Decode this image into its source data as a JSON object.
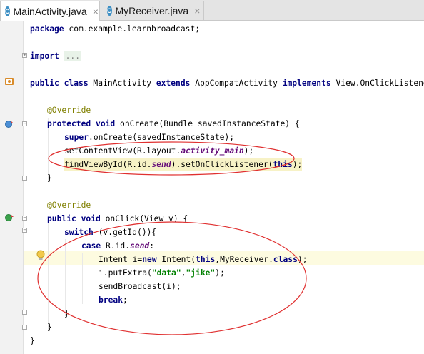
{
  "tabs": [
    {
      "icon": "C",
      "label": "MainActivity.java",
      "close": "×"
    },
    {
      "icon": "C",
      "label": "MyReceiver.java",
      "close": "×"
    }
  ],
  "code": {
    "l1": {
      "a": "package",
      "b": " com.example.learnbroadcast;"
    },
    "l2": {
      "a": "import",
      "b": "..."
    },
    "l3": {
      "a": "public class",
      "b": " MainActivity ",
      "c": "extends",
      "d": " AppCompatActivity ",
      "e": "implements",
      "f": " View.OnClickListener {"
    },
    "l4": {
      "a": "@Override"
    },
    "l5": {
      "a": "protected void",
      "b": " onCreate(Bundle savedInstanceState) {"
    },
    "l6": {
      "a": "super",
      "b": ".onCreate(savedInstanceState);"
    },
    "l7": {
      "a": "setContentView(R.layout.",
      "b": "activity_main",
      "c": ");"
    },
    "l8": {
      "a": "findViewById(R.id.",
      "b": "send",
      "c": ").setOnClickListener(",
      "d": "this",
      "e": ");"
    },
    "l9": {
      "a": "}"
    },
    "l10": {
      "a": "@Override"
    },
    "l11": {
      "a": "public void",
      "b": " onClick(View v) {"
    },
    "l12": {
      "a": "switch",
      "b": " (v.getId()){"
    },
    "l13": {
      "a": "case",
      "b": " R.id.",
      "c": "send",
      "d": ":"
    },
    "l14": {
      "a": "Intent i=",
      "b": "new",
      "c": " Intent(",
      "d": "this",
      "e": ",MyReceiver.",
      "f": "class",
      "g": ");"
    },
    "l15": {
      "a": "i.putExtra(",
      "b": "\"data\"",
      "c": ",",
      "d": "\"jike\"",
      "e": ");"
    },
    "l16": {
      "a": "sendBroadcast(i);"
    },
    "l17": {
      "a": "break",
      "b": ";"
    },
    "l18": {
      "a": "}"
    },
    "l19": {
      "a": "}"
    },
    "l20": {
      "a": "}"
    }
  },
  "colors": {
    "keyword": "#000080",
    "annotation": "#808000",
    "field": "#660e7a",
    "string": "#008000",
    "annotation_ellipse": "#e03030"
  }
}
